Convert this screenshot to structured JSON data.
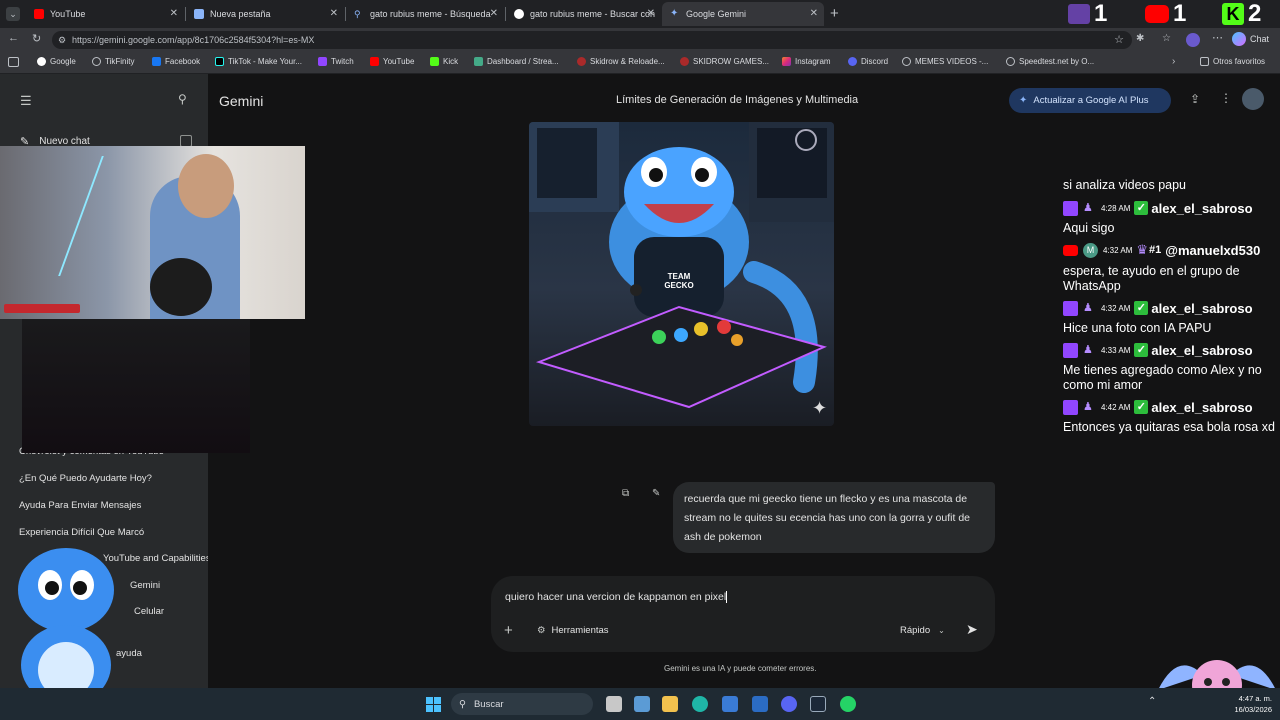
{
  "browser": {
    "tabs": [
      {
        "title": "YouTube",
        "color": "#ff0000"
      },
      {
        "title": "Nueva pestaña",
        "color": "#8ab4f8"
      },
      {
        "title": "gato rubius meme - Búsqueda",
        "color": "#8ab4f8"
      },
      {
        "title": "gato rubius meme - Buscar con Go",
        "color": "#ffffff"
      },
      {
        "title": "Google Gemini",
        "color": "#8ab4f8"
      }
    ],
    "url": "https://gemini.google.com/app/8c1706c2584f5304?hl=es-MX",
    "bookmarks": [
      "Google",
      "TikFinity",
      "Facebook",
      "TikTok - Make Your...",
      "Twitch",
      "YouTube",
      "Kick",
      "Dashboard / Strea...",
      "Skidrow & Reloade...",
      "SKIDROW GAMES...",
      "Instagram",
      "Discord",
      "MEMES VIDEOS -...",
      "Speedtest.net by O..."
    ],
    "other_favorites": "Otros favoritos",
    "chat_label": "Chat"
  },
  "viewers": {
    "twitch": "1",
    "youtube": "1",
    "kick": "2"
  },
  "gemini": {
    "brand": "Gemini",
    "header_title": "Límites de Generación de Imágenes y Multimedia",
    "upgrade_label": "Actualizar a Google AI Plus",
    "new_chat": "Nuevo chat",
    "recents": [
      "Chevrolet y comentas en YouTube",
      "¿En Qué Puedo Ayudarte Hoy?",
      "Ayuda Para Enviar Mensajes",
      "Experiencia Difícil Que Marcó",
      "YouTube and Capabilities",
      "Gemini",
      "Celular",
      "ayuda"
    ],
    "user_message": "recuerda que mi geecko tiene un flecko y es una mascota de stream no le quites su ecencia has uno con la gorra y oufit de ash de pokemon",
    "input_value": "quiero hacer una vercion de kappamon en pixel",
    "tools_label": "Herramientas",
    "mode_label": "Rápido",
    "disclaimer": "Gemini es una IA y puede cometer errores.",
    "image_jersey_text": "TEAM GECKO"
  },
  "stream_chat": [
    {
      "type": "message",
      "text": "si analiza videos papu"
    },
    {
      "type": "meta",
      "platform": "twitch",
      "time": "4:28 AM",
      "user": "alex_el_sabroso"
    },
    {
      "type": "message",
      "text": "Aqui sigo"
    },
    {
      "type": "meta",
      "platform": "youtube",
      "time": "4:32 AM",
      "user": "@manuelxd530",
      "badge": "#1"
    },
    {
      "type": "message",
      "text": "espera, te ayudo en el grupo de WhatsApp"
    },
    {
      "type": "meta",
      "platform": "twitch",
      "time": "4:32 AM",
      "user": "alex_el_sabroso"
    },
    {
      "type": "message",
      "text": "Hice una foto con IA PAPU"
    },
    {
      "type": "meta",
      "platform": "twitch",
      "time": "4:33 AM",
      "user": "alex_el_sabroso"
    },
    {
      "type": "message",
      "text": "Me tienes agregado como Alex y no como mi amor"
    },
    {
      "type": "meta",
      "platform": "twitch",
      "time": "4:42 AM",
      "user": "alex_el_sabroso"
    },
    {
      "type": "message",
      "text": "Entonces ya quitaras esa bola rosa xd"
    }
  ],
  "taskbar": {
    "search_label": "Buscar",
    "time": "4:47 a. m.",
    "date": "16/03/2026"
  }
}
